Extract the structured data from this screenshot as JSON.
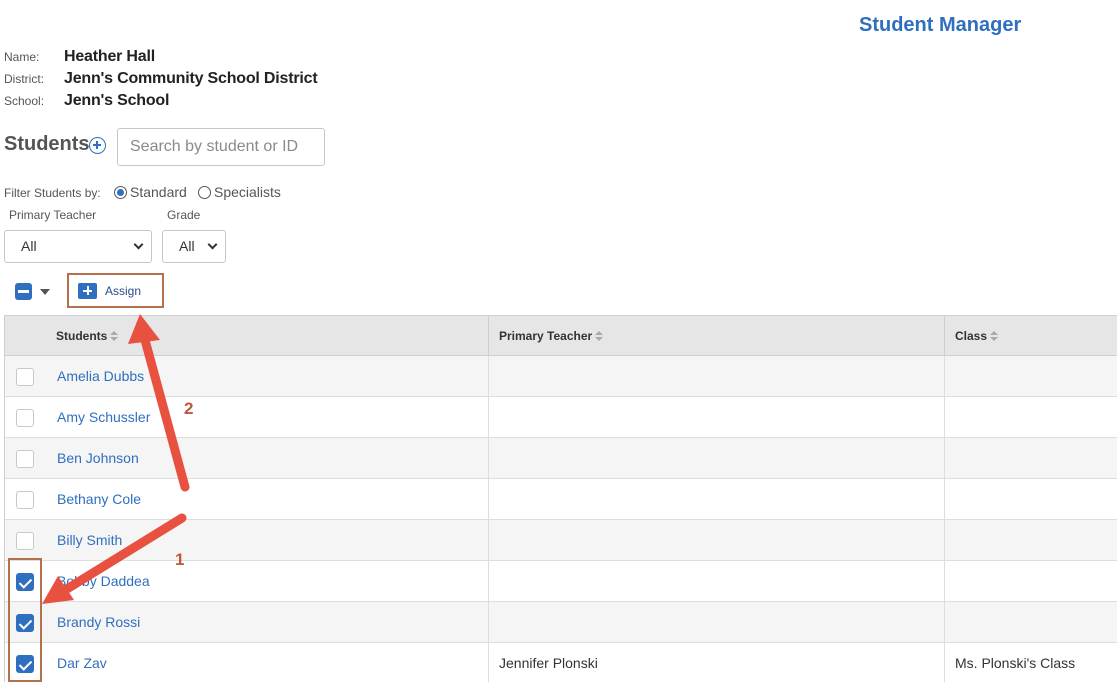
{
  "header": {
    "title": "Student Manager"
  },
  "info": [
    {
      "label": "Name:",
      "value": "Heather Hall"
    },
    {
      "label": "District:",
      "value": "Jenn's Community School District"
    },
    {
      "label": "School:",
      "value": "Jenn's School"
    }
  ],
  "students_section": {
    "heading": "Students",
    "search_placeholder": "Search by student or ID"
  },
  "filter": {
    "label": "Filter Students by:",
    "options": [
      {
        "label": "Standard",
        "selected": true
      },
      {
        "label": "Specialists",
        "selected": false
      }
    ]
  },
  "selects": {
    "primary_teacher": {
      "label": "Primary Teacher",
      "value": "All"
    },
    "grade": {
      "label": "Grade",
      "value": "All"
    }
  },
  "toolbar": {
    "assign_label": "Assign"
  },
  "table": {
    "columns": [
      "Students",
      "Primary Teacher",
      "Class"
    ],
    "rows": [
      {
        "student": "Amelia Dubbs",
        "teacher": "",
        "class": "",
        "checked": false
      },
      {
        "student": "Amy Schussler",
        "teacher": "",
        "class": "",
        "checked": false
      },
      {
        "student": "Ben Johnson",
        "teacher": "",
        "class": "",
        "checked": false
      },
      {
        "student": "Bethany Cole",
        "teacher": "",
        "class": "",
        "checked": false
      },
      {
        "student": "Billy Smith",
        "teacher": "",
        "class": "",
        "checked": false
      },
      {
        "student": "Bobby Daddea",
        "teacher": "",
        "class": "",
        "checked": true
      },
      {
        "student": "Brandy Rossi",
        "teacher": "",
        "class": "",
        "checked": true
      },
      {
        "student": "Dar Zav",
        "teacher": "Jennifer Plonski",
        "class": "Ms. Plonski's Class",
        "checked": true
      }
    ]
  },
  "annotations": {
    "step1": "1",
    "step2": "2"
  },
  "colors": {
    "accent": "#2f6fbf",
    "annotation_red": "#e8503f",
    "annotation_box": "#b5704d"
  }
}
